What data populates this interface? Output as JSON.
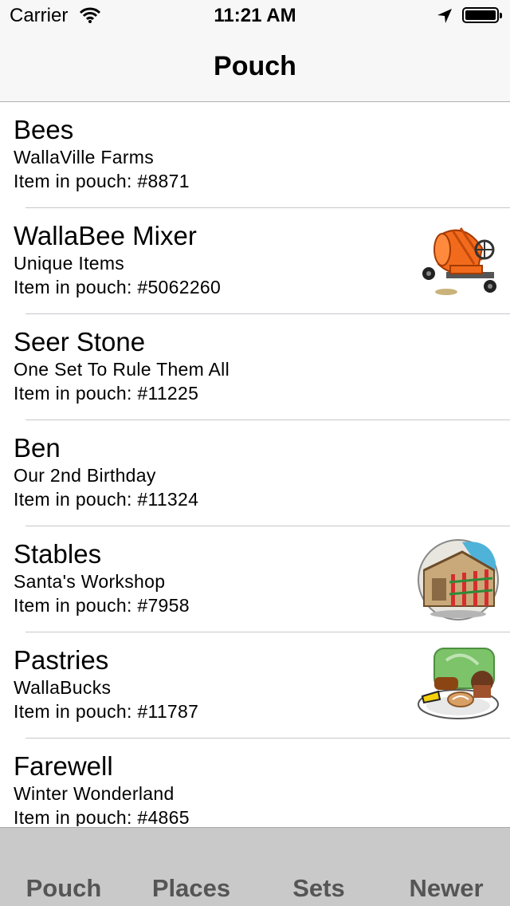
{
  "status": {
    "carrier": "Carrier",
    "time": "11:21 AM"
  },
  "nav": {
    "title": "Pouch"
  },
  "items": [
    {
      "name": "Bees",
      "set": "WallaVille Farms",
      "pouch": "Item in pouch: #8871",
      "thumb": ""
    },
    {
      "name": "WallaBee Mixer",
      "set": "Unique Items",
      "pouch": "Item in pouch: #5062260",
      "thumb": "cement-mixer"
    },
    {
      "name": "Seer Stone",
      "set": "One Set To Rule Them All",
      "pouch": "Item in pouch: #11225",
      "thumb": ""
    },
    {
      "name": "Ben",
      "set": "Our 2nd Birthday",
      "pouch": "Item in pouch: #11324",
      "thumb": ""
    },
    {
      "name": "Stables",
      "set": "Santa's Workshop",
      "pouch": "Item in pouch: #7958",
      "thumb": "stables"
    },
    {
      "name": "Pastries",
      "set": "WallaBucks",
      "pouch": "Item in pouch: #11787",
      "thumb": "pastries"
    },
    {
      "name": "Farewell",
      "set": "Winter Wonderland",
      "pouch": "Item in pouch: #4865",
      "thumb": ""
    }
  ],
  "tabs": [
    {
      "label": "Pouch"
    },
    {
      "label": "Places"
    },
    {
      "label": "Sets"
    },
    {
      "label": "Newer"
    }
  ]
}
